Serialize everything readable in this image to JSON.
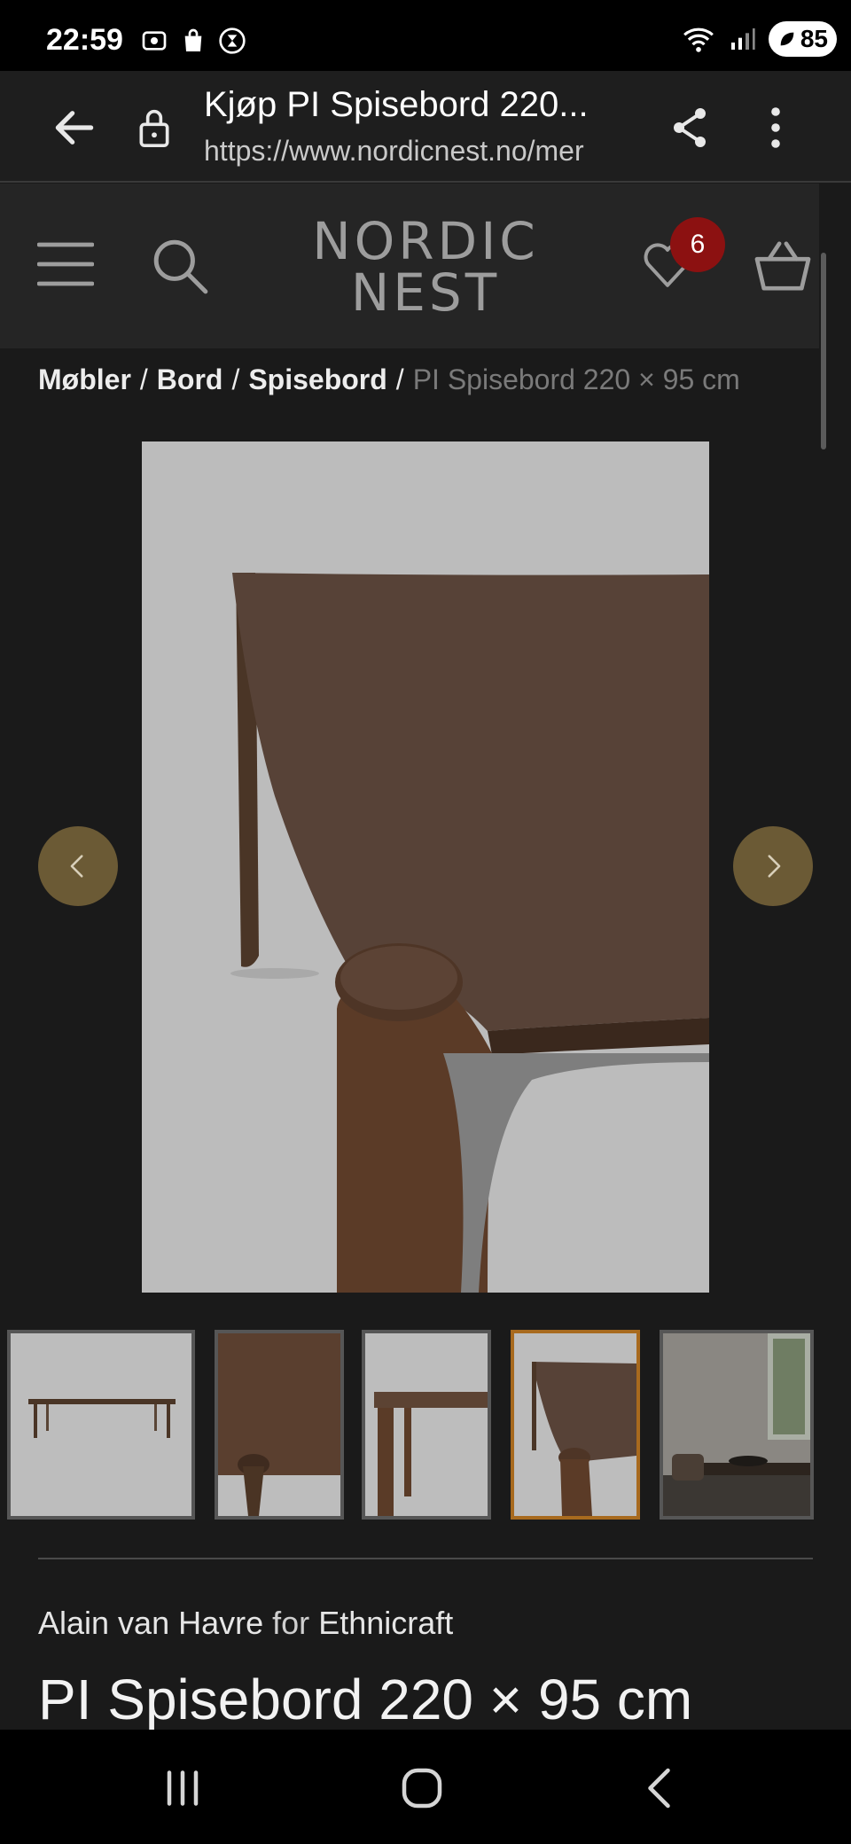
{
  "status_bar": {
    "time": "22:59",
    "battery": "85",
    "icons_left": [
      "screen-record-icon",
      "shopping-bag-icon",
      "app-icon"
    ],
    "icons_right": [
      "wifi-icon",
      "signal-icon",
      "battery-icon"
    ]
  },
  "browser": {
    "page_title": "Kjøp PI Spisebord 220...",
    "url": "https://www.nordicnest.no/mer"
  },
  "site_header": {
    "logo_line1": "NORDIC",
    "logo_line2": "NEST",
    "wishlist_count": "6"
  },
  "breadcrumb": {
    "items": [
      "Møbler",
      "Bord",
      "Spisebord"
    ],
    "separator": "/",
    "current": "PI Spisebord 220 × 95 cm"
  },
  "gallery": {
    "thumbnail_count": 5,
    "active_index": 3
  },
  "product": {
    "designer": "Alain van Havre",
    "for_text": "for",
    "brand": "Ethnicraft",
    "title": "PI Spisebord 220 × 95 cm"
  },
  "colors": {
    "badge": "#8c1111",
    "arrow_button": "#6b5a35",
    "active_thumb_border": "#a86a1e"
  }
}
